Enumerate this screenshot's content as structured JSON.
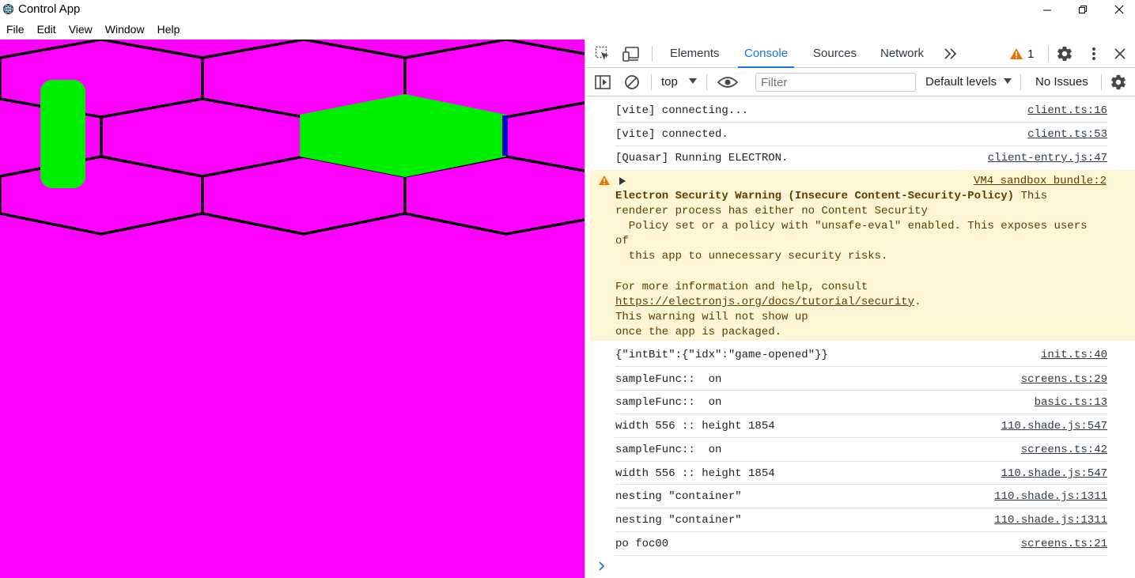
{
  "window": {
    "title": "Control App",
    "controls": [
      "minimize",
      "maximize",
      "close"
    ]
  },
  "menu": [
    "File",
    "Edit",
    "View",
    "Window",
    "Help"
  ],
  "game": {
    "background": "#ff00ff",
    "hex_color": "#ff00ff",
    "player_color": "#00ee00",
    "accent_color": "#0000cc"
  },
  "devtools": {
    "tabs": [
      "Elements",
      "Console",
      "Sources",
      "Network"
    ],
    "active_tab": "Console",
    "warning_count": "1",
    "context": "top",
    "filter_placeholder": "Filter",
    "levels": "Default levels",
    "issues": "No Issues"
  },
  "console": {
    "messages_top": [
      {
        "text": "[vite] connecting...",
        "src": "client.ts:16"
      },
      {
        "text": "[vite] connected.",
        "src": "client.ts:53"
      },
      {
        "text": "[Quasar] Running ELECTRON.",
        "src": "client-entry.js:47"
      }
    ],
    "warning": {
      "src": "VM4 sandbox_bundle:2",
      "title": "Electron Security Warning (Insecure Content-Security-Policy)",
      "title_rest": " This",
      "l2": "renderer process has either no Content Security",
      "l3": "  Policy set or a policy with \"unsafe-eval\" enabled. This exposes users",
      "l4": "of",
      "l5": "  this app to unnecessary security risks.",
      "l6": "For more information and help, consult",
      "l7_link": "https://electronjs.org/docs/tutorial/security",
      "l7_rest": ".",
      "l8": "This warning will not show up",
      "l9": "once the app is packaged."
    },
    "messages_bottom": [
      {
        "text": "{\"intBit\":{\"idx\":\"game-opened\"}}",
        "src": "init.ts:40"
      },
      {
        "text": "sampleFunc::  on",
        "src": "screens.ts:29"
      },
      {
        "text": "sampleFunc::  on",
        "src": "basic.ts:13"
      },
      {
        "text": "width 556 :: height 1854",
        "src": "110.shade.js:547"
      },
      {
        "text": "sampleFunc::  on",
        "src": "screens.ts:42"
      },
      {
        "text": "width 556 :: height 1854",
        "src": "110.shade.js:547"
      },
      {
        "text": "nesting \"container\"",
        "src": "110.shade.js:1311"
      },
      {
        "text": "nesting \"container\"",
        "src": "110.shade.js:1311"
      },
      {
        "text": "po foc00",
        "src": "screens.ts:21"
      }
    ]
  }
}
